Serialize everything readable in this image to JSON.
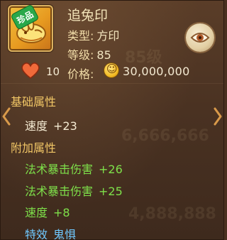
{
  "item": {
    "name": "追兔印",
    "badge": "珍品",
    "type_label": "类型:",
    "type_value": "方印",
    "level_label": "等级:",
    "level_value": "85",
    "likes": "10",
    "price_label": "价格:",
    "price_value": "30,000,000"
  },
  "sections": {
    "base_title": "基础属性",
    "extra_title": "附加属性"
  },
  "base_attributes": [
    {
      "name": "速度",
      "value": "+23"
    }
  ],
  "extra_attributes": [
    {
      "name": "法术暴击伤害",
      "value": "+26"
    },
    {
      "name": "法术暴击伤害",
      "value": "+25"
    },
    {
      "name": "速度",
      "value": "+8"
    },
    {
      "name": "特效",
      "value": "鬼惧"
    }
  ],
  "colors": {
    "section_title": "#f2c766",
    "extra_attr": "#7ee04a",
    "special_effect": "#6fc8ff",
    "badge": "#29a84a"
  },
  "icons": [
    "rabbit-seal-icon",
    "eye-icon",
    "heart-icon",
    "coin-icon",
    "arrow-left-icon",
    "arrow-right-icon"
  ]
}
